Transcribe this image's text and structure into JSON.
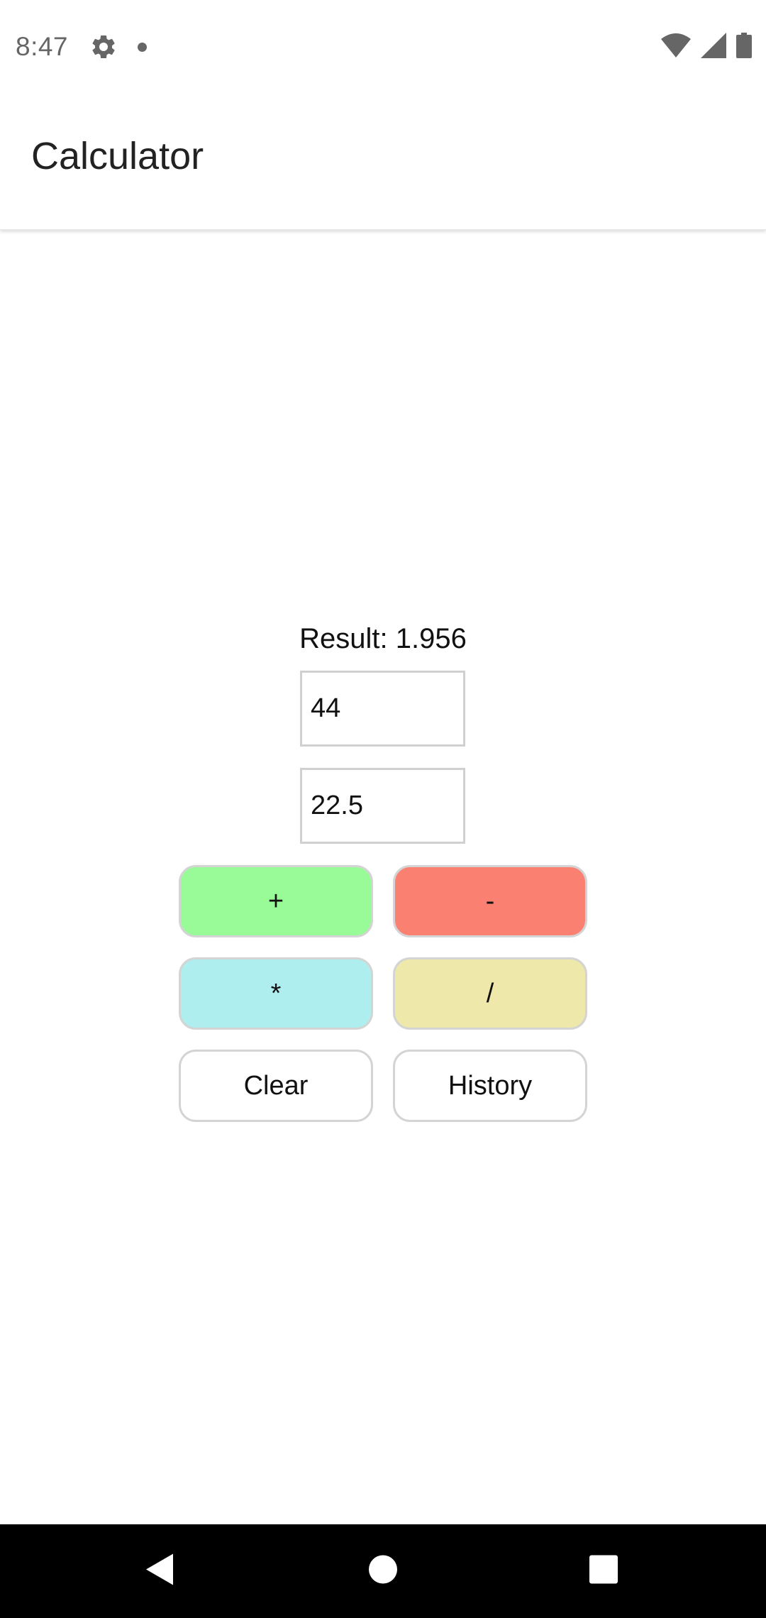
{
  "status_bar": {
    "time": "8:47",
    "icons": [
      "gear-icon",
      "notification-dot-icon",
      "wifi-icon",
      "cell-signal-icon",
      "battery-icon"
    ]
  },
  "app_bar": {
    "title": "Calculator"
  },
  "calculator": {
    "result_text": "Result: 1.956",
    "input_a": "44",
    "input_b": "22.5",
    "buttons": {
      "add": {
        "label": "+",
        "color": "#98FB98"
      },
      "subtract": {
        "label": "-",
        "color": "#FA8072"
      },
      "multiply": {
        "label": "*",
        "color": "#AFEEEE"
      },
      "divide": {
        "label": "/",
        "color": "#EEE8AA"
      },
      "clear": {
        "label": "Clear",
        "color": "#FFFFFF"
      },
      "history": {
        "label": "History",
        "color": "#FFFFFF"
      }
    }
  },
  "nav_bar": {
    "icons": [
      "back-icon",
      "home-icon",
      "recents-icon"
    ]
  }
}
